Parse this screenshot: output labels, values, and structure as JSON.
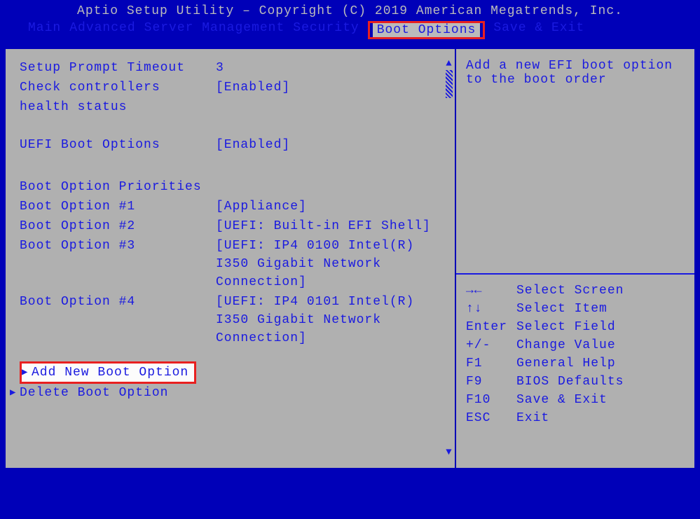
{
  "header": {
    "title": "Aptio Setup Utility – Copyright (C) 2019 American Megatrends, Inc."
  },
  "tabs": {
    "main": "Main",
    "advanced": "Advanced",
    "server_mgmt": "Server Management",
    "security": "Security",
    "boot_options": "Boot Options",
    "save_exit": "Save & Exit"
  },
  "settings": {
    "setup_prompt_timeout": {
      "label": "Setup Prompt Timeout",
      "value": "3"
    },
    "check_controllers": {
      "label": "Check controllers",
      "value": "[Enabled]"
    },
    "health_status": {
      "label": "health status"
    },
    "uefi_boot_options": {
      "label": "UEFI Boot Options",
      "value": "[Enabled]"
    },
    "priorities_header": "Boot Option Priorities",
    "boot1": {
      "label": "Boot Option #1",
      "value": "[Appliance]"
    },
    "boot2": {
      "label": "Boot Option #2",
      "value": "[UEFI: Built-in EFI Shell]"
    },
    "boot3": {
      "label": "Boot Option #3",
      "value": "[UEFI: IP4 0100 Intel(R) I350 Gigabit Network Connection]"
    },
    "boot4": {
      "label": "Boot Option #4",
      "value": "[UEFI: IP4 0101 Intel(R) I350 Gigabit Network Connection]"
    }
  },
  "menu": {
    "add_new": "Add New Boot Option",
    "delete": "Delete Boot Option"
  },
  "help": {
    "text": "Add a new EFI boot option to the boot order"
  },
  "hotkeys": {
    "select_screen": {
      "key": "→←",
      "label": "Select Screen"
    },
    "select_item": {
      "key": "↑↓",
      "label": "Select Item"
    },
    "select_field": {
      "key": "Enter",
      "label": "Select Field"
    },
    "change_value": {
      "key": "+/-",
      "label": "Change Value"
    },
    "general_help": {
      "key": "F1",
      "label": "General Help"
    },
    "bios_defaults": {
      "key": "F9",
      "label": "BIOS Defaults"
    },
    "save_exit": {
      "key": "F10",
      "label": "Save & Exit"
    },
    "exit": {
      "key": "ESC",
      "label": "Exit"
    }
  }
}
